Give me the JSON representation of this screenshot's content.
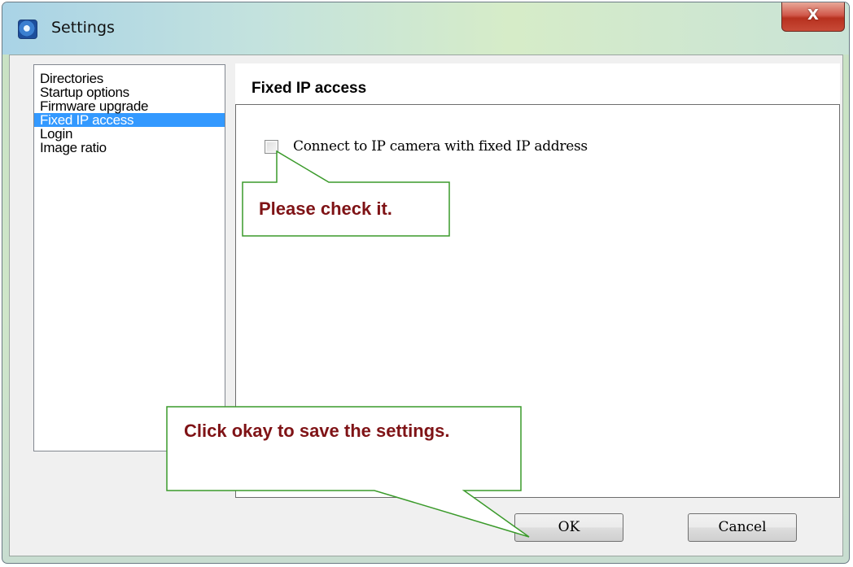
{
  "window": {
    "title": "Settings",
    "close_glyph": "X"
  },
  "sidebar": {
    "items": [
      {
        "label": "Directories",
        "selected": false
      },
      {
        "label": "Startup options",
        "selected": false
      },
      {
        "label": "Firmware upgrade",
        "selected": false
      },
      {
        "label": "Fixed IP access",
        "selected": true
      },
      {
        "label": "Login",
        "selected": false
      },
      {
        "label": "Image ratio",
        "selected": false
      }
    ]
  },
  "panel": {
    "title": "Fixed IP access",
    "checkbox_label": "Connect to IP camera with fixed IP address",
    "checkbox_checked": false
  },
  "buttons": {
    "ok_label": "OK",
    "cancel_label": "Cancel"
  },
  "callouts": {
    "check_hint": "Please check it.",
    "ok_hint": "Click okay to save the settings.",
    "border_color": "#3a9a2a",
    "text_color": "#7f1316"
  },
  "colors": {
    "selection": "#3399ff",
    "close_button": "#c8412f"
  },
  "icons": {
    "app": "app-camera-icon",
    "close": "close-icon"
  }
}
